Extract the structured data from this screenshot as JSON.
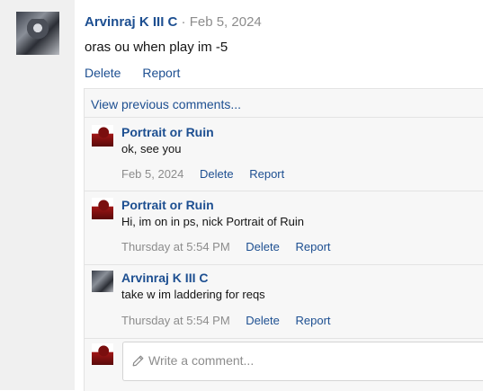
{
  "post": {
    "author": "Arvinraj K III C",
    "separator": "·",
    "date": "Feb 5, 2024",
    "text": "oras ou when play im -5",
    "actions": {
      "delete": "Delete",
      "report": "Report"
    }
  },
  "comments": {
    "view_previous": "View previous comments...",
    "items": [
      {
        "author": "Portrait or Ruin",
        "text": "ok, see you",
        "time": "Feb 5, 2024",
        "delete": "Delete",
        "report": "Report"
      },
      {
        "author": "Portrait or Ruin",
        "text": "Hi, im on in ps, nick Portrait of Ruin",
        "time": "Thursday at 5:54 PM",
        "delete": "Delete",
        "report": "Report"
      },
      {
        "author": "Arvinraj K III C",
        "text": "take w im laddering for reqs",
        "time": "Thursday at 5:54 PM",
        "delete": "Delete",
        "report": "Report"
      }
    ],
    "compose": {
      "placeholder": "Write a comment..."
    }
  },
  "colors": {
    "link": "#1d4f91",
    "muted": "#8c8c8c",
    "panel": "#f7f7f7",
    "rail": "#f0f0f0"
  },
  "icons": {
    "compose": "pencil-icon"
  }
}
